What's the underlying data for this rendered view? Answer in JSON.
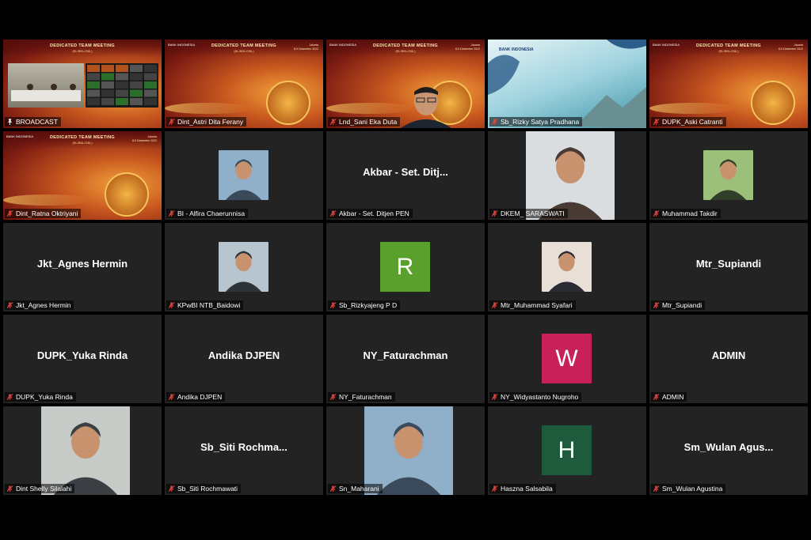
{
  "tiles": [
    {
      "label": "BROADCAST",
      "kind": "broadcast",
      "muted": false,
      "active": true
    },
    {
      "label": "Dint_Astri Dita Ferany",
      "kind": "slide",
      "muted": true
    },
    {
      "label": "Lnd_Sani Eka Duta",
      "kind": "slide-person",
      "muted": true
    },
    {
      "label": "Sb_Rizky Satya Pradhana",
      "kind": "bg-blue",
      "muted": true
    },
    {
      "label": "DUPK_Aski Catranti",
      "kind": "slide",
      "muted": true
    },
    {
      "label": "Dint_Ratna Oktriyani",
      "kind": "slide",
      "muted": true
    },
    {
      "label": "BI - Alfira Chaerunnisa",
      "kind": "photo",
      "muted": true
    },
    {
      "big": "Akbar - Set. Ditj...",
      "label": "Akbar - Set. Ditjen PEN",
      "kind": "name",
      "muted": true
    },
    {
      "label": "DKEM_ SARASWATI",
      "kind": "photo-large",
      "muted": true
    },
    {
      "label": "Muhammad Takdir",
      "kind": "photo",
      "muted": true
    },
    {
      "big": "Jkt_Agnes Hermin",
      "label": "Jkt_Agnes Hermin",
      "kind": "name",
      "muted": true
    },
    {
      "label": "KPwBI NTB_Baidowi",
      "kind": "photo",
      "muted": true
    },
    {
      "avatar": "R",
      "label": "Sb_Rizkyajeng P D",
      "kind": "avatar",
      "color": "#5aa02c",
      "muted": true
    },
    {
      "label": "Mtr_Muhammad Syafari",
      "kind": "photo",
      "muted": true
    },
    {
      "big": "Mtr_Supiandi",
      "label": "Mtr_Supiandi",
      "kind": "name",
      "muted": true
    },
    {
      "big": "DUPK_Yuka Rinda",
      "label": "DUPK_Yuka Rinda",
      "kind": "name",
      "muted": true
    },
    {
      "big": "Andika DJPEN",
      "label": "Andika DJPEN",
      "kind": "name",
      "muted": true
    },
    {
      "big": "NY_Faturachman",
      "label": "NY_Faturachman",
      "kind": "name",
      "muted": true
    },
    {
      "avatar": "W",
      "label": "NY_Widyastanto Nugroho",
      "kind": "avatar",
      "color": "#c8215a",
      "muted": true
    },
    {
      "big": "ADMIN",
      "label": "ADMIN",
      "kind": "name",
      "muted": true
    },
    {
      "label": "Dint Shelly Silalahi",
      "kind": "photo-large",
      "muted": true
    },
    {
      "big": "Sb_Siti  Rochma...",
      "label": "Sb_Siti Rochmawati",
      "kind": "name",
      "muted": true
    },
    {
      "label": "Sn_Maharani",
      "kind": "photo-large",
      "muted": true
    },
    {
      "avatar": "H",
      "label": "Haszna Salsabila",
      "kind": "avatar",
      "color": "#1e5a3c",
      "muted": true
    },
    {
      "big": "Sm_Wulan  Agus...",
      "label": "Sm_Wulan Agustina",
      "kind": "name",
      "muted": true
    }
  ],
  "slide": {
    "title": "DEDICATED TEAM MEETING",
    "subtitle": "(BL/BBL/GBL)",
    "location": "Jakarta",
    "date": "8-9 Desember 2022",
    "logo": "BANK INDONESIA"
  },
  "colors": {
    "active_border": "#d6e04a",
    "muted_icon": "#e0443e",
    "tile_bg": "#232323"
  }
}
